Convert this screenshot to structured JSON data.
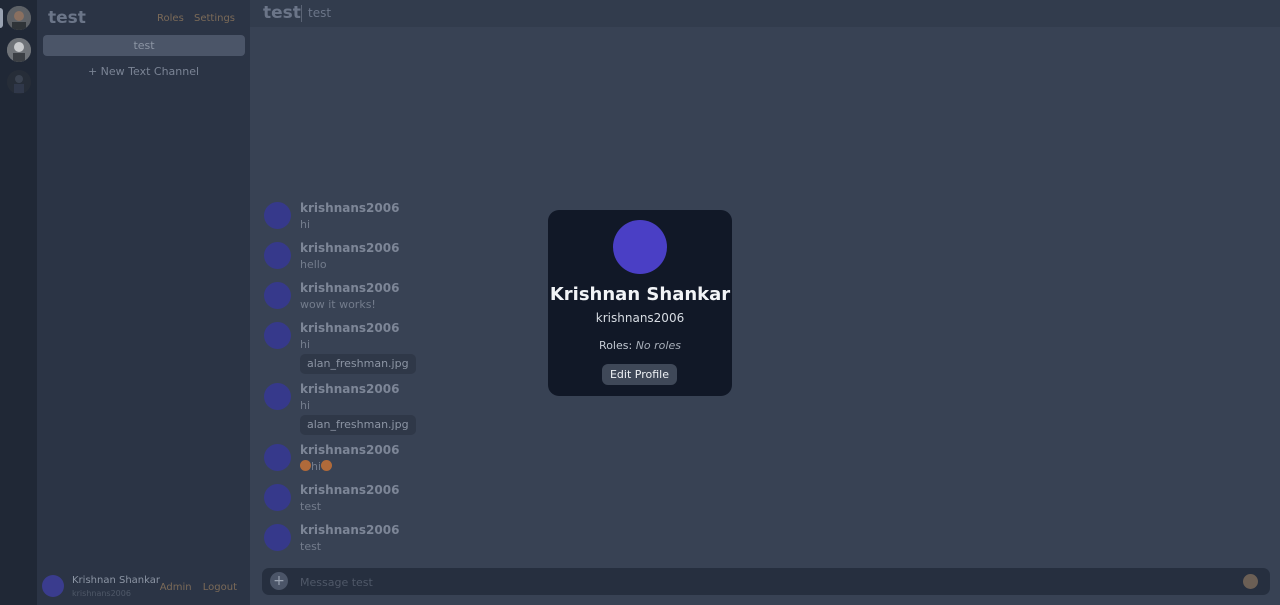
{
  "server": {
    "name": "test",
    "roles_link": "Roles",
    "settings_link": "Settings"
  },
  "channels": {
    "active": "test",
    "new_channel_label": "+ New Text Channel"
  },
  "header": {
    "channel": "test",
    "topic": "test"
  },
  "messages": [
    {
      "author": "krishnans2006",
      "text": "hi"
    },
    {
      "author": "krishnans2006",
      "text": "hello"
    },
    {
      "author": "krishnans2006",
      "text": "wow it works!"
    },
    {
      "author": "krishnans2006",
      "text": "hi",
      "attachment": "alan_freshman.jpg"
    },
    {
      "author": "krishnans2006",
      "text": "hi",
      "attachment": "alan_freshman.jpg"
    },
    {
      "author": "krishnans2006",
      "text": "hi",
      "emoji": "smiley-emoji"
    },
    {
      "author": "krishnans2006",
      "text": "test"
    },
    {
      "author": "krishnans2006",
      "text": "test"
    }
  ],
  "user_panel": {
    "name": "Krishnan Shankar",
    "username": "krishnans2006",
    "admin_label": "Admin",
    "logout_label": "Logout"
  },
  "composer": {
    "placeholder": "Message test",
    "add_icon": "+"
  },
  "profile_popup": {
    "name": "Krishnan Shankar",
    "username": "krishnans2006",
    "roles_label": "Roles:",
    "roles_value": "No roles",
    "edit_button": "Edit Profile"
  },
  "colors": {
    "avatar": "#4a3fc5",
    "background": "#384254",
    "popup": "#111827"
  }
}
